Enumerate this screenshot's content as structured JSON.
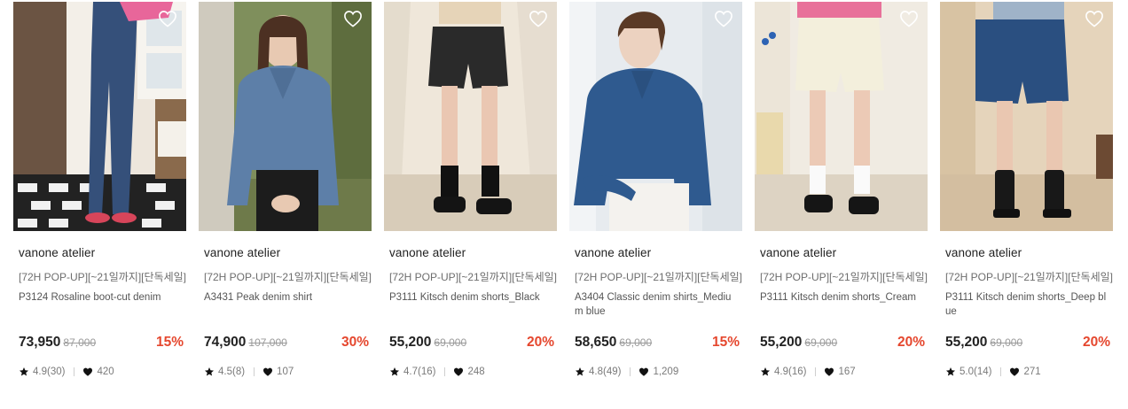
{
  "products": [
    {
      "brand": "vanone atelier",
      "promo": "[72H POP-UP][~21일까지][단독세일]",
      "name": "P3124 Rosaline boot-cut denim",
      "price": "73,950",
      "original_price": "87,000",
      "discount": "15%",
      "rating": "4.9(30)",
      "likes": "420",
      "image": "model-bootcut-denim-jeans"
    },
    {
      "brand": "vanone atelier",
      "promo": "[72H POP-UP][~21일까지][단독세일]",
      "name": "A3431 Peak denim shirt",
      "price": "74,900",
      "original_price": "107,000",
      "discount": "30%",
      "rating": "4.5(8)",
      "likes": "107",
      "image": "model-denim-shirt"
    },
    {
      "brand": "vanone atelier",
      "promo": "[72H POP-UP][~21일까지][단독세일]",
      "name": "P3111 Kitsch denim shorts_Black",
      "price": "55,200",
      "original_price": "69,000",
      "discount": "20%",
      "rating": "4.7(16)",
      "likes": "248",
      "image": "model-black-denim-shorts"
    },
    {
      "brand": "vanone atelier",
      "promo": "[72H POP-UP][~21일까지][단독세일]",
      "name": "A3404 Classic denim shirts_Medium blue",
      "price": "58,650",
      "original_price": "69,000",
      "discount": "15%",
      "rating": "4.8(49)",
      "likes": "1,209",
      "image": "model-medium-blue-denim-shirt"
    },
    {
      "brand": "vanone atelier",
      "promo": "[72H POP-UP][~21일까지][단독세일]",
      "name": "P3111 Kitsch denim shorts_Cream",
      "price": "55,200",
      "original_price": "69,000",
      "discount": "20%",
      "rating": "4.9(16)",
      "likes": "167",
      "image": "model-cream-denim-shorts"
    },
    {
      "brand": "vanone atelier",
      "promo": "[72H POP-UP][~21일까지][단독세일]",
      "name": "P3111 Kitsch denim shorts_Deep blue",
      "price": "55,200",
      "original_price": "69,000",
      "discount": "20%",
      "rating": "5.0(14)",
      "likes": "271",
      "image": "model-deep-blue-denim-shorts"
    }
  ],
  "colors": {
    "discount": "#e5472e",
    "price": "#222222",
    "original_price": "#9a9a9a",
    "meta": "#7a7a7a"
  },
  "icons": {
    "wishlist": "heart-outline-icon",
    "rating": "star-icon",
    "likes": "heart-filled-icon"
  }
}
